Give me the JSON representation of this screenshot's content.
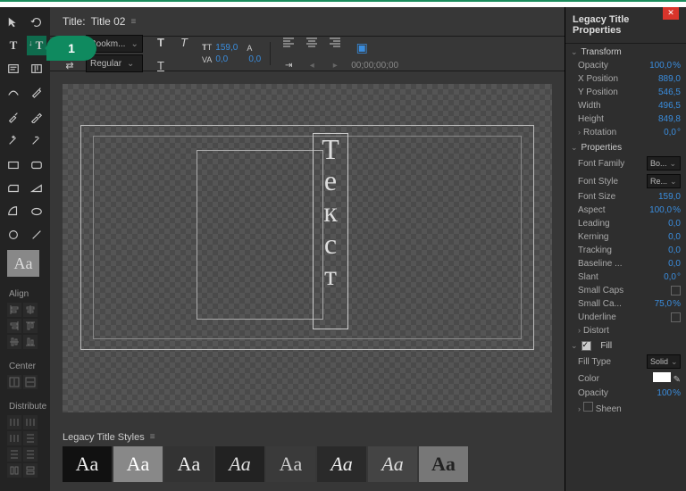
{
  "header": {
    "title_prefix": "Title:",
    "title_name": "Title 02"
  },
  "callout": "1",
  "tools_aa": "Aa",
  "align_label": "Align",
  "center_label": "Center",
  "distribute_label": "Distribute",
  "toolbar": {
    "font_family": "Bookm...",
    "font_style": "Regular",
    "font_size": "159,0",
    "kerning": "0,0",
    "leading": "0,0",
    "timecode": "00;00;00;00"
  },
  "canvas_text": [
    "Т",
    "е",
    "к",
    "с",
    "т"
  ],
  "styles": {
    "label": "Legacy Title Styles",
    "swatches": [
      "Aa",
      "Aa",
      "Aa",
      "Aa",
      "Aa",
      "Aa",
      "Aa",
      "Aa"
    ]
  },
  "props": {
    "header": "Legacy Title Properties",
    "sections": {
      "transform": "Transform",
      "properties": "Properties",
      "fill": "Fill"
    },
    "transform": {
      "opacity_l": "Opacity",
      "opacity_v": "100,0",
      "opacity_u": "%",
      "xpos_l": "X Position",
      "xpos_v": "889,0",
      "ypos_l": "Y Position",
      "ypos_v": "546,5",
      "width_l": "Width",
      "width_v": "496,5",
      "height_l": "Height",
      "height_v": "849,8",
      "rot_l": "Rotation",
      "rot_v": "0,0",
      "rot_u": "°"
    },
    "properties": {
      "ff_l": "Font Family",
      "ff_v": "Bo...",
      "fs_l": "Font Style",
      "fs_v": "Re...",
      "fsize_l": "Font Size",
      "fsize_v": "159,0",
      "aspect_l": "Aspect",
      "aspect_v": "100,0",
      "aspect_u": "%",
      "lead_l": "Leading",
      "lead_v": "0,0",
      "kern_l": "Kerning",
      "kern_v": "0,0",
      "track_l": "Tracking",
      "track_v": "0,0",
      "base_l": "Baseline ...",
      "base_v": "0,0",
      "slant_l": "Slant",
      "slant_v": "0,0",
      "slant_u": "°",
      "scaps_l": "Small Caps",
      "scapsz_l": "Small Ca...",
      "scapsz_v": "75,0",
      "scapsz_u": "%",
      "under_l": "Underline",
      "distort_l": "Distort"
    },
    "fill": {
      "ftype_l": "Fill Type",
      "ftype_v": "Solid",
      "color_l": "Color",
      "opacity_l": "Opacity",
      "opacity_v": "100",
      "opacity_u": "%",
      "sheen_l": "Sheen"
    }
  }
}
